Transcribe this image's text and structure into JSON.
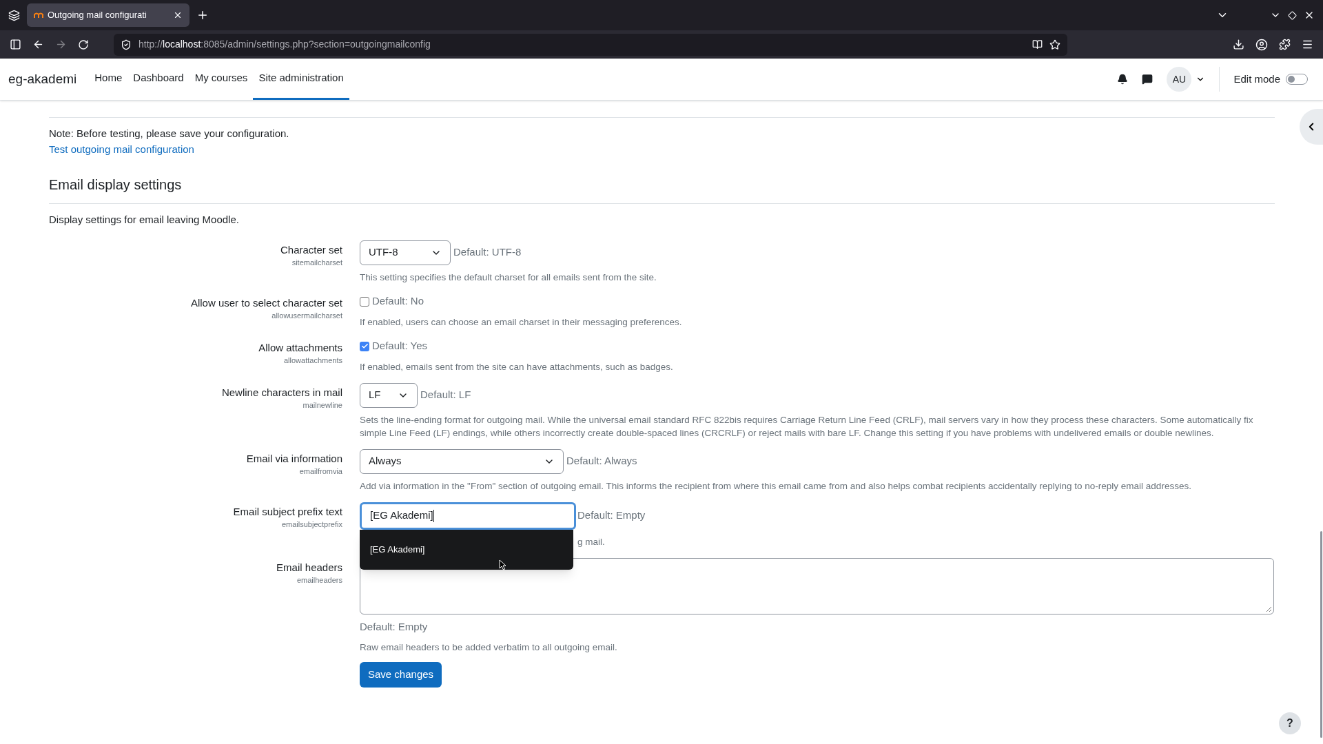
{
  "browser": {
    "tabs": [
      {
        "title": "Outgoing mail configurati",
        "selected": true
      }
    ],
    "url": {
      "scheme": "http://",
      "host": "localhost",
      "path": ":8085/admin/settings.php?section=outgoingmailconfig"
    }
  },
  "navbar": {
    "site_name": "eg-akademi",
    "items": [
      {
        "label": "Home",
        "selected": false
      },
      {
        "label": "Dashboard",
        "selected": false
      },
      {
        "label": "My courses",
        "selected": false
      },
      {
        "label": "Site administration",
        "selected": true
      }
    ],
    "avatar": "AU",
    "edit_mode": {
      "label": "Edit mode",
      "on": false
    }
  },
  "note": "Note: Before testing, please save your configuration.",
  "test_link": "Test outgoing mail configuration",
  "section": {
    "title": "Email display settings",
    "description": "Display settings for email leaving Moodle.",
    "settings": [
      {
        "kind": "select",
        "label": "Character set",
        "name": "sitemailcharset",
        "value": "UTF-8",
        "default": "Default: UTF-8",
        "help": "This setting specifies the default charset for all emails sent from the site."
      },
      {
        "kind": "checkbox",
        "label": "Allow user to select character set",
        "name": "allowusermailcharset",
        "checked": false,
        "default": "Default: No",
        "help": "If enabled, users can choose an email charset in their messaging preferences."
      },
      {
        "kind": "checkbox",
        "label": "Allow attachments",
        "name": "allowattachments",
        "checked": true,
        "default": "Default: Yes",
        "help": "If enabled, emails sent from the site can have attachments, such as badges."
      },
      {
        "kind": "select",
        "label": "Newline characters in mail",
        "name": "mailnewline",
        "value": "LF",
        "default": "Default: LF",
        "help": "Sets the line-ending format for outgoing mail. While the universal email standard RFC 822bis requires Carriage Return Line Feed (CRLF), mail servers vary in how they process these characters. Some automatically fix simple Line Feed (LF) endings, while others incorrectly create double-spaced lines (CRCRLF) or reject mails with bare LF. Change this setting if you have problems with undelivered emails or double newlines."
      },
      {
        "kind": "select",
        "label": "Email via information",
        "name": "emailfromvia",
        "value": "Always",
        "default": "Default: Always",
        "help": "Add via information in the \"From\" section of outgoing email. This informs the recipient from where this email came from and also helps combat recipients accidentally replying to no-reply email addresses."
      },
      {
        "kind": "text",
        "label": "Email subject prefix text",
        "name": "emailsubjectprefix",
        "value": "[EG Akademi]",
        "focused": true,
        "default": "Default: Empty",
        "suggestions": [
          "[EG Akademi]"
        ],
        "help": "g mail."
      },
      {
        "kind": "textarea",
        "label": "Email headers",
        "name": "emailheaders",
        "default": "Default: Empty",
        "help": "Raw email headers to be added verbatim to all outgoing email."
      }
    ]
  },
  "save_button": "Save changes",
  "help_button": "?"
}
